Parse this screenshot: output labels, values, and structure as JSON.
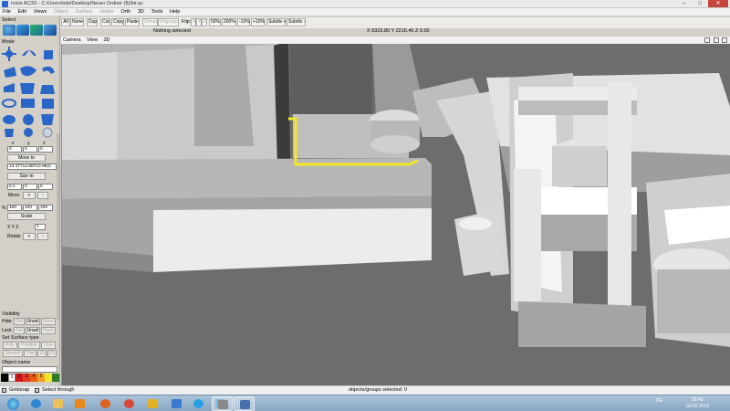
{
  "window": {
    "title": "Inivis AC3D - C:/Users/tobi/Desktop/Neuer Ordner (8)/ktr.ac",
    "minimize": "─",
    "maximize": "□",
    "close": "✕"
  },
  "menu": [
    {
      "label": "File",
      "enabled": true
    },
    {
      "label": "Edit",
      "enabled": true
    },
    {
      "label": "Views",
      "enabled": true
    },
    {
      "label": "Object",
      "enabled": false
    },
    {
      "label": "Surface",
      "enabled": false
    },
    {
      "label": "Vertex",
      "enabled": false
    },
    {
      "label": "Orth",
      "enabled": true
    },
    {
      "label": "3D",
      "enabled": true
    },
    {
      "label": "Tools",
      "enabled": true
    },
    {
      "label": "Help",
      "enabled": true
    }
  ],
  "toolbar": {
    "all": "All",
    "none": "None",
    "dup": "Dup",
    "cut": "Cut",
    "copy": "Copy",
    "paste": "Paste",
    "group": "Group",
    "ungroup": "Ungroup",
    "flip_label": "Flip:",
    "flip_x": "X",
    "flip_y": "Y",
    "flip_z": "Z",
    "zoom": [
      "50%",
      "200%",
      "-10%",
      "+10%"
    ],
    "subdiv_plus": "Subdiv +",
    "subdiv_minus": "Subdiv -",
    "status": "Nothing selected",
    "coords": "X 5323.80 Y 2216.40 Z 0.00"
  },
  "leftpanel": {
    "select_label": "Select",
    "mode_label": "Mode",
    "axis_x": "x",
    "axis_y": "y",
    "axis_z": "z",
    "move_fields": [
      "0",
      "0",
      "0"
    ],
    "move_to": "Move to",
    "position": "13.47714.68713.99(C",
    "size_to": "Size to",
    "move_delta": [
      "0.1",
      "0",
      "0"
    ],
    "move": "Move",
    "plus": "+",
    "minus": "-",
    "scale_prefix": "%",
    "scale_fields": [
      "100",
      "100",
      "100"
    ],
    "scale": "Scale",
    "rotate_axes": "X Y Z",
    "rotate_value": "1",
    "rotate": "Rotate",
    "visibility_label": "Visibility",
    "hide_label": "Hide:",
    "lock_label": "Lock:",
    "sel": "Sel",
    "unsel": "Unsel",
    "none": "None",
    "surface_type_label": "Set Surface type",
    "poly": "Poly",
    "polyline": "Polyline",
    "line": "Line",
    "smooth": "Smooth",
    "flat": "Flat",
    "s1": "1S",
    "s2": "2S",
    "object_name_label": "Object name",
    "palette_labels": [
      "1",
      "2",
      "3",
      "4",
      "5"
    ]
  },
  "tool_icons": [
    "select-icon",
    "stereo-icon",
    "select-surface-icon",
    "select-object-icon",
    "select-group-icon",
    "move-icon",
    "rotate-icon",
    "scale-icon",
    "polygon-icon",
    "polyline-icon",
    "loop-icon",
    "bend-icon",
    "ellipse-icon",
    "rectangle-icon",
    "box-icon",
    "mesh-icon",
    "disc-icon",
    "sphere-icon",
    "ghost-icon",
    "cylinder-icon",
    "cone-icon",
    "tube-icon",
    "light-icon"
  ],
  "colors": {
    "accent_blue": "#2a66c7",
    "selection_yellow": "#f3e626",
    "palette": [
      "#000000",
      "#ffffff",
      "#d11a1a",
      "#e33a2a",
      "#e65f10",
      "#f0a020",
      "#2c7a2a",
      "#f3e626"
    ]
  },
  "viewport": {
    "tabs": [
      "Camera",
      "View",
      "3D"
    ]
  },
  "statusbar": {
    "gridsnap": "Gridsnap",
    "select_through": "Select through",
    "selected_count": "objects/groups selected: 0"
  },
  "taskbar": {
    "apps": [
      "start-orb",
      "internet-explorer-icon",
      "file-explorer-icon",
      "media-player-icon",
      "firefox-icon",
      "chrome-icon",
      "app-icon",
      "paint-icon",
      "skype-icon",
      "photo-icon",
      "fax-icon",
      "ac3d-icon",
      "tool-icon"
    ],
    "lang": "DE",
    "time": "20:45",
    "date": "03.02.2013"
  }
}
